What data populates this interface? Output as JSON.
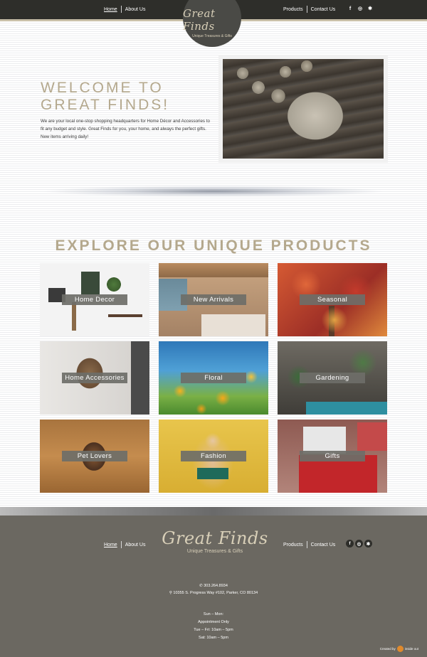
{
  "nav": {
    "home": "Home",
    "about": "About Us",
    "products": "Products",
    "contact": "Contact Us"
  },
  "social": {
    "facebook": "f",
    "instagram": "◎",
    "yelp": "✱"
  },
  "logo": {
    "script": "Great Finds",
    "tagline": "Unique Treasures & Gifts"
  },
  "hero": {
    "title_line1": "WELCOME TO",
    "title_line2": "GREAT FINDS!",
    "text": "We are your local one-stop shopping headquarters for Home Décor and Accessories to fit any budget and style. Great Finds for you, your home, and always the perfect gifts. New items arriving daily!"
  },
  "products": {
    "title": "EXPLORE OUR UNIQUE PRODUCTS",
    "tiles": [
      "Home Decor",
      "New Arrivals",
      "Seasonal",
      "Home Accessories",
      "Floral",
      "Gardening",
      "Pet Lovers",
      "Fashion",
      "Gifts"
    ]
  },
  "footer": {
    "phone": "303.264.8934",
    "address": "10355 S. Progress Way #102, Parker, CO 80134",
    "hours": [
      "Sun – Mon:",
      "Appointment Only",
      "Tue – Fri: 10am – 5pm",
      "Sat: 10am – 5pm"
    ],
    "credit_label": "Created by",
    "credit_name": "inside out"
  },
  "colors": {
    "header_bg": "#2e2e2a",
    "accent_gold": "#b4a88d",
    "footer_bg": "#6b6861",
    "tile_label_bg": "#6e6e68"
  }
}
